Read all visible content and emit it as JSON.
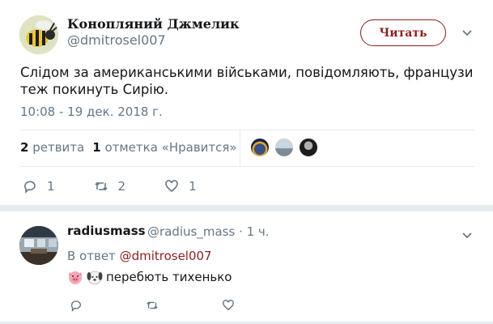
{
  "tweet": {
    "display_name": "Конопляний Джмелик",
    "handle": "@dmitrosel007",
    "follow_label": "Читать",
    "text": "Слідом за американськими військами, повідомляють, французи теж покинуть Сирію.",
    "timestamp": "10:08 - 19 дек. 2018 г.",
    "stats": {
      "retweets_count": "2",
      "retweets_label": "ретвита",
      "likes_count": "1",
      "likes_label": "отметка «Нравится»"
    },
    "actions": {
      "reply_count": "1",
      "retweet_count": "2",
      "like_count": "1"
    }
  },
  "reply": {
    "display_name": "radiusmass",
    "handle_meta": "@radius_mass · 1 ч.",
    "in_reply_prefix": "В ответ",
    "in_reply_handle": "@dmitrosel007",
    "text": "перебють тихенько",
    "emojis": [
      "pig-face-icon",
      "dog-face-icon"
    ]
  },
  "colors": {
    "accent": "#8c1f1f",
    "muted": "#657786",
    "divider": "#e6ecf0"
  }
}
